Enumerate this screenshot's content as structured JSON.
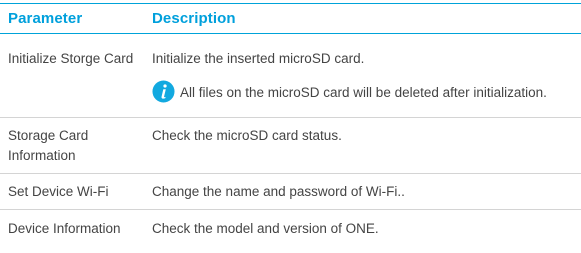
{
  "header": {
    "parameter": "Parameter",
    "description": "Description"
  },
  "rows": [
    {
      "parameter": "Initialize Storge Card",
      "description": "Initialize the inserted microSD card.",
      "note": "All files on the microSD card will be deleted after initialization."
    },
    {
      "parameter": "Storage Card Information",
      "description": "Check the microSD card status."
    },
    {
      "parameter": "Set Device Wi-Fi",
      "description": "Change the name and password of Wi-Fi.."
    },
    {
      "parameter": "Device Information",
      "description": "Check the model and version of ONE."
    }
  ],
  "colors": {
    "accent": "#00a0dc",
    "text": "#444444",
    "divider": "#d4d4d4"
  },
  "icons": {
    "note_icon": "info-icon"
  }
}
